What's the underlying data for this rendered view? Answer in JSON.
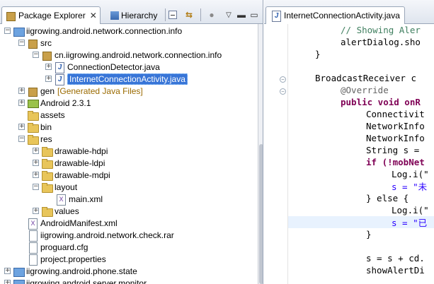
{
  "left_tabs": {
    "package_explorer": "Package Explorer",
    "hierarchy": "Hierarchy",
    "close_glyph": "✕"
  },
  "tree": {
    "project1": "iigrowing.android.network.connection.info",
    "src": "src",
    "package": "cn.iigrowing.android.network.connection.info",
    "file1": "ConnectionDetector.java",
    "file2": "InternetConnectionActivity.java",
    "gen": "gen",
    "gen_decoration": "[Generated Java Files]",
    "android": "Android 2.3.1",
    "assets": "assets",
    "bin": "bin",
    "res": "res",
    "hdpi": "drawable-hdpi",
    "ldpi": "drawable-ldpi",
    "mdpi": "drawable-mdpi",
    "layout": "layout",
    "mainxml": "main.xml",
    "values": "values",
    "manifest": "AndroidManifest.xml",
    "rar": "iigrowing.android.network.check.rar",
    "proguard": "proguard.cfg",
    "projprops": "project.properties",
    "project2": "iigrowing.android.phone.state",
    "project3": "iigrowing.android.server.monitor"
  },
  "editor": {
    "tab_title": "InternetConnectionActivity.java",
    "lines": [
      "// Showing Aler",
      "alertDialog.sho",
      "}",
      "",
      "BroadcastReceiver c",
      "@Override",
      "public void onR",
      "Connectivit",
      "NetworkInfo",
      "NetworkInfo",
      "String s =",
      "if (!mobNet",
      "Log.i(\"",
      "s = \"未",
      "} else {",
      "Log.i(\"",
      "s = \"已",
      "}",
      "",
      "s = s + cd.",
      "showAlertDi"
    ]
  },
  "colors": {
    "selection": "#3875d7",
    "keyword": "#7f0055",
    "comment": "#3f7f5f",
    "string": "#2a00ff",
    "current_line": "#e8f2fe"
  }
}
